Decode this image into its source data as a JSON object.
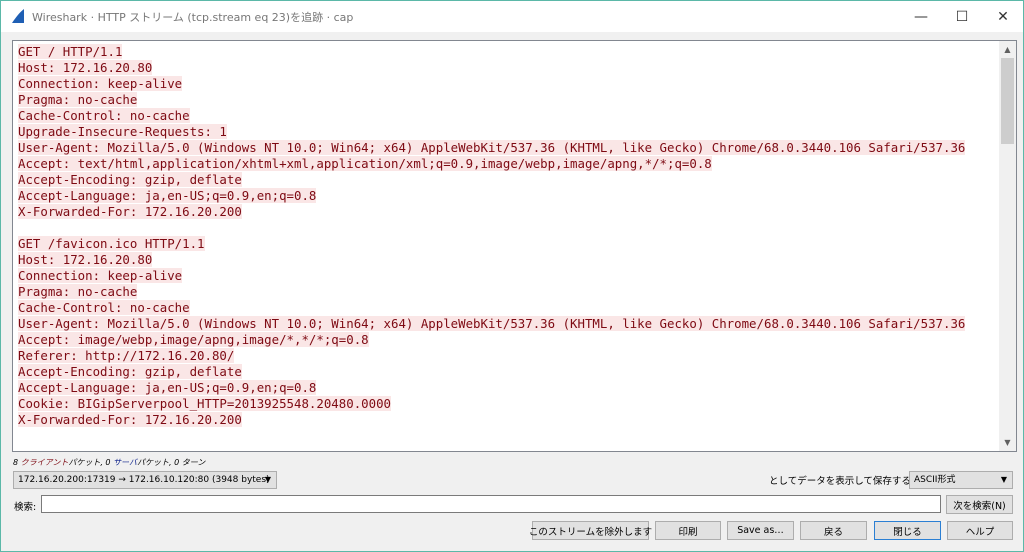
{
  "window": {
    "title": "Wireshark · HTTP ストリーム (tcp.stream eq 23)を追跡 · cap",
    "minimize_glyph": "—",
    "maximize_glyph": "☐",
    "close_glyph": "✕"
  },
  "stream": {
    "lines": [
      "GET / HTTP/1.1",
      "Host: 172.16.20.80",
      "Connection: keep-alive",
      "Pragma: no-cache",
      "Cache-Control: no-cache",
      "Upgrade-Insecure-Requests: 1",
      "User-Agent: Mozilla/5.0 (Windows NT 10.0; Win64; x64) AppleWebKit/537.36 (KHTML, like Gecko) Chrome/68.0.3440.106 Safari/537.36",
      "Accept: text/html,application/xhtml+xml,application/xml;q=0.9,image/webp,image/apng,*/*;q=0.8",
      "Accept-Encoding: gzip, deflate",
      "Accept-Language: ja,en-US;q=0.9,en;q=0.8",
      "X-Forwarded-For: 172.16.20.200",
      "",
      "GET /favicon.ico HTTP/1.1",
      "Host: 172.16.20.80",
      "Connection: keep-alive",
      "Pragma: no-cache",
      "Cache-Control: no-cache",
      "User-Agent: Mozilla/5.0 (Windows NT 10.0; Win64; x64) AppleWebKit/537.36 (KHTML, like Gecko) Chrome/68.0.3440.106 Safari/537.36",
      "Accept: image/webp,image/apng,image/*,*/*;q=0.8",
      "Referer: http://172.16.20.80/",
      "Accept-Encoding: gzip, deflate",
      "Accept-Language: ja,en-US;q=0.9,en;q=0.8",
      "Cookie: BIGipServerpool_HTTP=2013925548.20480.0000",
      "X-Forwarded-For: 172.16.20.200"
    ],
    "client_color": "#7e0a13",
    "client_bg": "#fae6e6"
  },
  "summary": {
    "client_count": "8",
    "client_label": "クライアント",
    "client_suffix": "パケット, 0",
    "server_label": "サーバ",
    "server_suffix": "パケット, 0 ターン"
  },
  "conversation_select": {
    "value": "172.16.20.200:17319 → 172.16.10.120:80 (3948 bytes)"
  },
  "save_as": {
    "label": "としてデータを表示して保存する",
    "format_value": "ASCII形式"
  },
  "find": {
    "label": "検索:",
    "value": "",
    "next_button": "次を検索(N)"
  },
  "buttons": {
    "filter_out": "このストリームを除外します",
    "print": "印刷",
    "save_as": "Save as…",
    "back": "戻る",
    "close": "閉じる",
    "help": "ヘルプ"
  }
}
